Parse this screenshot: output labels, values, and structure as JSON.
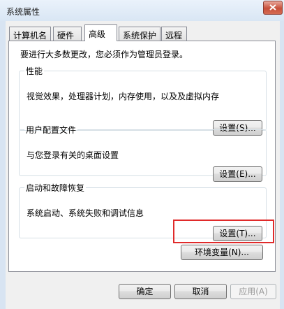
{
  "window": {
    "title": "系统属性",
    "close_icon": "close-icon"
  },
  "tabs": [
    {
      "label": "计算机名",
      "active": false
    },
    {
      "label": "硬件",
      "active": false
    },
    {
      "label": "高级",
      "active": true
    },
    {
      "label": "系统保护",
      "active": false
    },
    {
      "label": "远程",
      "active": false
    }
  ],
  "advanced": {
    "notice": "要进行大多数更改，您必须作为管理员登录。",
    "performance": {
      "title": "性能",
      "description": "视觉效果，处理器计划，内存使用，以及及虚拟内存",
      "settings_button": "设置(S)..."
    },
    "user_profiles": {
      "title": "用户配置文件",
      "description": "与您登录有关的桌面设置",
      "settings_button": "设置(E)..."
    },
    "startup_recovery": {
      "title": "启动和故障恢复",
      "description": "系统启动、系统失败和调试信息",
      "settings_button": "设置(T)..."
    },
    "env_vars_button": "环境变量(N)..."
  },
  "footer": {
    "ok_button": "确定",
    "cancel_button": "取消",
    "apply_button": "应用(A)"
  },
  "colors": {
    "highlight": "#e02a2a",
    "titlebar": "#d9e6f4"
  }
}
